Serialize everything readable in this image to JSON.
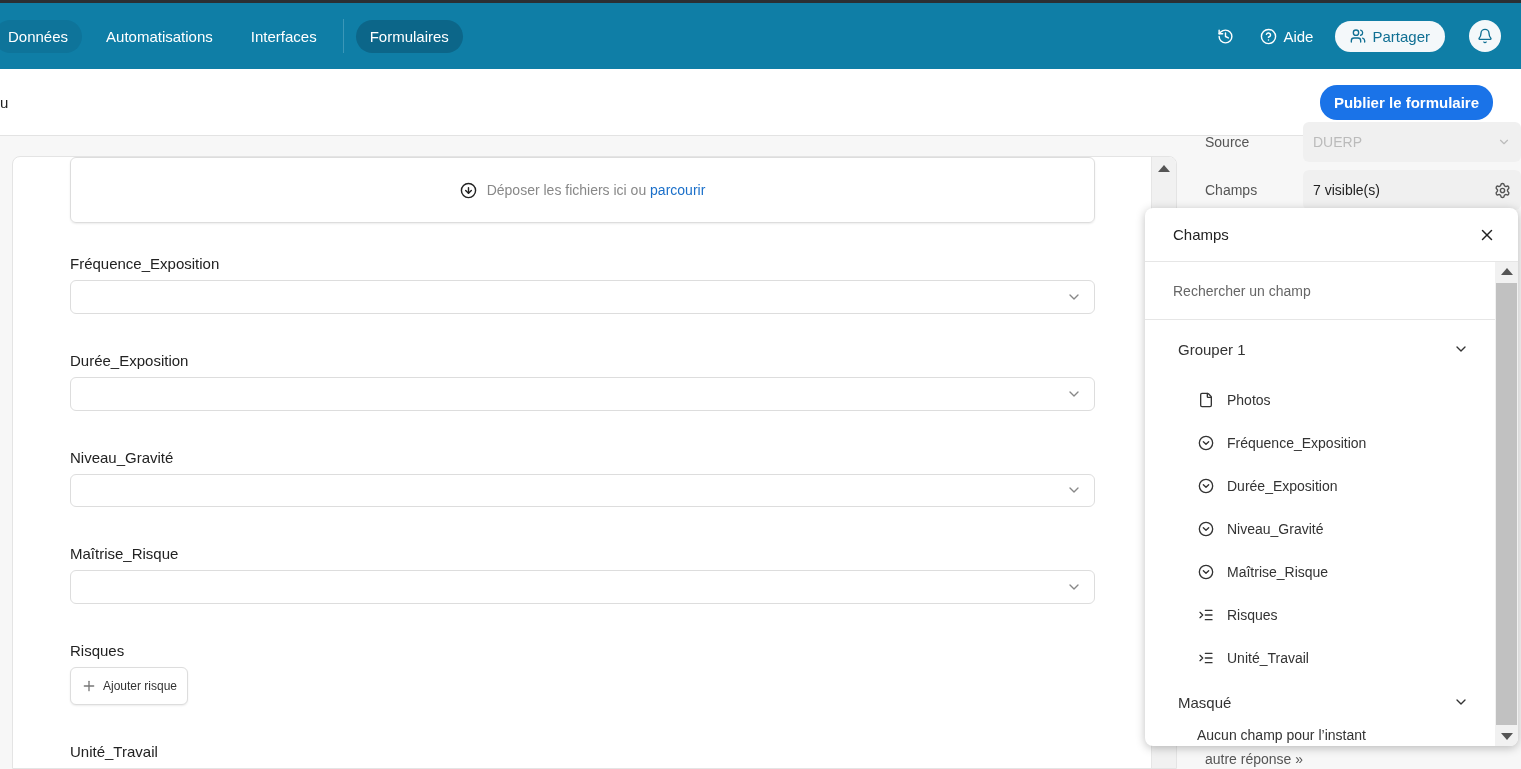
{
  "nav": {
    "sections": [
      {
        "tabs": [
          {
            "label": "Données",
            "selected": true
          },
          {
            "label": "Automatisations",
            "selected": false
          },
          {
            "label": "Interfaces",
            "selected": false
          }
        ]
      },
      {
        "tabs": [
          {
            "label": "Formulaires",
            "selected": true
          }
        ]
      }
    ],
    "help": "Aide",
    "share": "Partager"
  },
  "subheader": {
    "title": "u",
    "publish": "Publier le formulaire"
  },
  "form": {
    "dropzone": {
      "text": "Déposer les fichiers ici ou",
      "link": "parcourir"
    },
    "fields": [
      {
        "label": "Fréquence_Exposition",
        "kind": "select"
      },
      {
        "label": "Durée_Exposition",
        "kind": "select"
      },
      {
        "label": "Niveau_Gravité",
        "kind": "select"
      },
      {
        "label": "Maîtrise_Risque",
        "kind": "select"
      },
      {
        "label": "Risques",
        "kind": "add",
        "button": "Ajouter risque"
      },
      {
        "label": "Unité_Travail",
        "kind": "label"
      }
    ]
  },
  "settings": {
    "rows": [
      {
        "label": "Source",
        "value": "DUERP",
        "kind": "select",
        "disabled": true
      },
      {
        "label": "Champs",
        "value": "7 visible(s)",
        "kind": "settings",
        "disabled": false
      }
    ],
    "footer": "autre réponse »"
  },
  "popover": {
    "title": "Champs",
    "search": {
      "placeholder": "Rechercher un champ"
    },
    "groups": [
      {
        "name": "Grouper 1",
        "expanded": true,
        "items": [
          {
            "label": "Photos",
            "kind": "file"
          },
          {
            "label": "Fréquence_Exposition",
            "kind": "select"
          },
          {
            "label": "Durée_Exposition",
            "kind": "select"
          },
          {
            "label": "Niveau_Gravité",
            "kind": "select"
          },
          {
            "label": "Maîtrise_Risque",
            "kind": "select"
          },
          {
            "label": "Risques",
            "kind": "list"
          },
          {
            "label": "Unité_Travail",
            "kind": "list"
          }
        ]
      },
      {
        "name": "Masqué",
        "expanded": true,
        "empty": "Aucun champ pour l’instant"
      }
    ]
  }
}
